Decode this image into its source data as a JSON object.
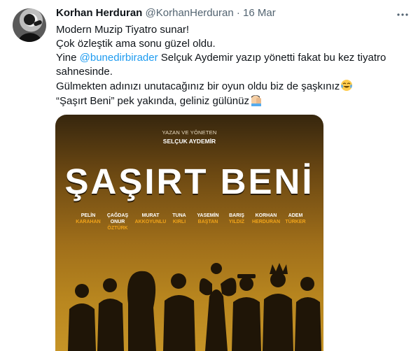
{
  "tweet": {
    "author_name": "Korhan Herduran",
    "handle": "@KorhanHerduran",
    "separator": "·",
    "timestamp": "16 Mar",
    "lines": {
      "l1": "Modern Muzip Tiyatro sunar!",
      "l2": "Çok özleştik ama sonu güzel oldu.",
      "l3_pre": "Yine ",
      "l3_mention": "@bunedirbirader",
      "l3_post": " Selçuk Aydemir yazıp yönetti fakat bu kez tiyatro",
      "l4": "sahnesinde.",
      "l5": "Gülmekten adınızı unutacağınız bir oyun oldu biz de şaşkınız",
      "l6": "“Şaşırt Beni” pek yakında, geliniz gülünüz"
    },
    "emojis": [
      "tears-of-joy-emoji",
      "person-facepalming-emoji"
    ],
    "colors": {
      "mention": "#1d9bf0",
      "secondary_text": "#536471",
      "primary_text": "#0f1419"
    }
  },
  "poster": {
    "kicker": "YAZAN VE YÖNETEN",
    "director": "SELÇUK AYDEMİR",
    "title": "ŞAŞIRT BENİ",
    "cast": [
      {
        "first": "PELİN",
        "last": "KARAHAN"
      },
      {
        "first": "ÇAĞDAŞ ONUR",
        "last": "ÖZTÜRK"
      },
      {
        "first": "MURAT",
        "last": "AKKOYUNLU"
      },
      {
        "first": "TUNA",
        "last": "KIRLI"
      },
      {
        "first": "YASEMİN",
        "last": "BAŞTAN"
      },
      {
        "first": "BARIŞ",
        "last": "YILDIZ"
      },
      {
        "first": "KORHAN",
        "last": "HERDURAN"
      },
      {
        "first": "ADEM",
        "last": "TÜRKER"
      }
    ],
    "colors": {
      "accent": "#f1a41a",
      "dark": "#1f1507"
    }
  }
}
